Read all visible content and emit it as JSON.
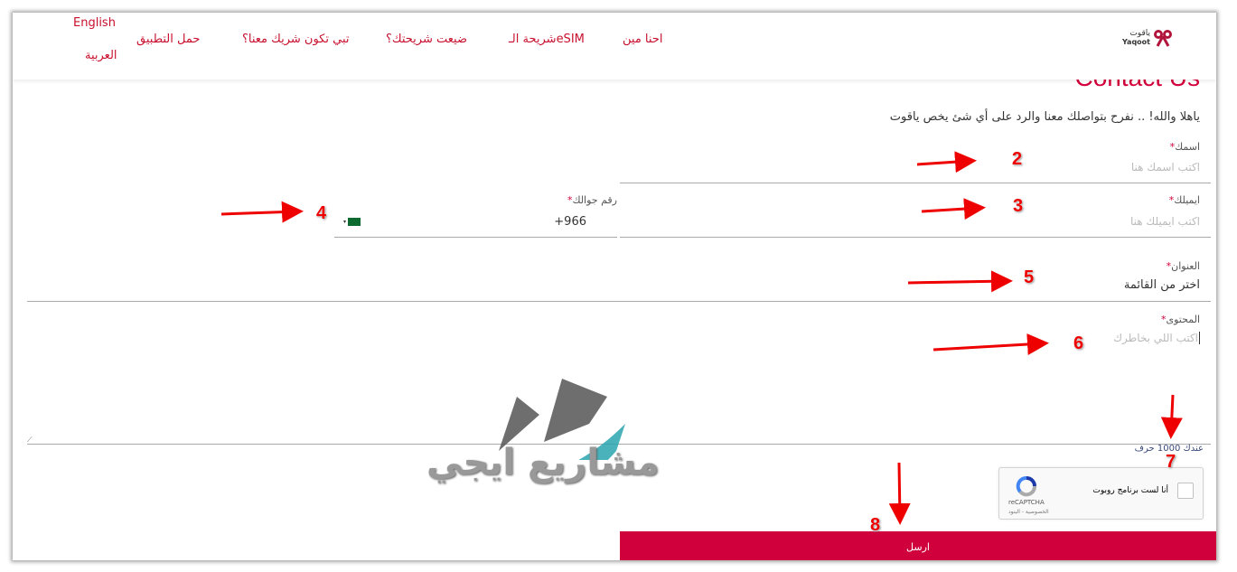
{
  "header": {
    "logo": {
      "text_ar": "ياقوت",
      "text_en": "Yaqoot"
    },
    "nav": [
      "احنا مين",
      "شريحة الـeSIM",
      "ضيعت شريحتك؟",
      "تبي تكون شريك معنا؟",
      "حمل التطبيق"
    ],
    "lang": {
      "english": "English",
      "arabic": "العربية"
    }
  },
  "page": {
    "title": "Contact Us",
    "subtitle": "ياهلا والله! .. نفرح بتواصلك معنا والرد على أي شئ يخص ياقوت"
  },
  "form": {
    "name": {
      "label": "اسمك",
      "placeholder": "اكتب اسمك هنا"
    },
    "email": {
      "label": "ايميلك",
      "placeholder": "اكتب ايميلك هنا"
    },
    "phone": {
      "label": "رقم جوالك",
      "value": "966+",
      "country": "Saudi Arabia"
    },
    "subject": {
      "label": "العنوان",
      "value": "اختر من القائمة"
    },
    "content": {
      "label": "المحتوى",
      "placeholder": "اكتب اللي بخاطرك"
    },
    "counter": "عندك 1000 حرف",
    "recaptcha": {
      "label": "أنا لست برنامج روبوت",
      "brand": "reCAPTCHA",
      "links": "الخصوصية - البنود"
    },
    "submit": "ارسل"
  },
  "required_mark": "*",
  "annotations": [
    "2",
    "3",
    "4",
    "5",
    "6",
    "7",
    "8"
  ],
  "watermark": "مشاريع ايجي",
  "colors": {
    "brand": "#d4003a",
    "submit": "#d0003c",
    "annotation": "#e00000"
  }
}
